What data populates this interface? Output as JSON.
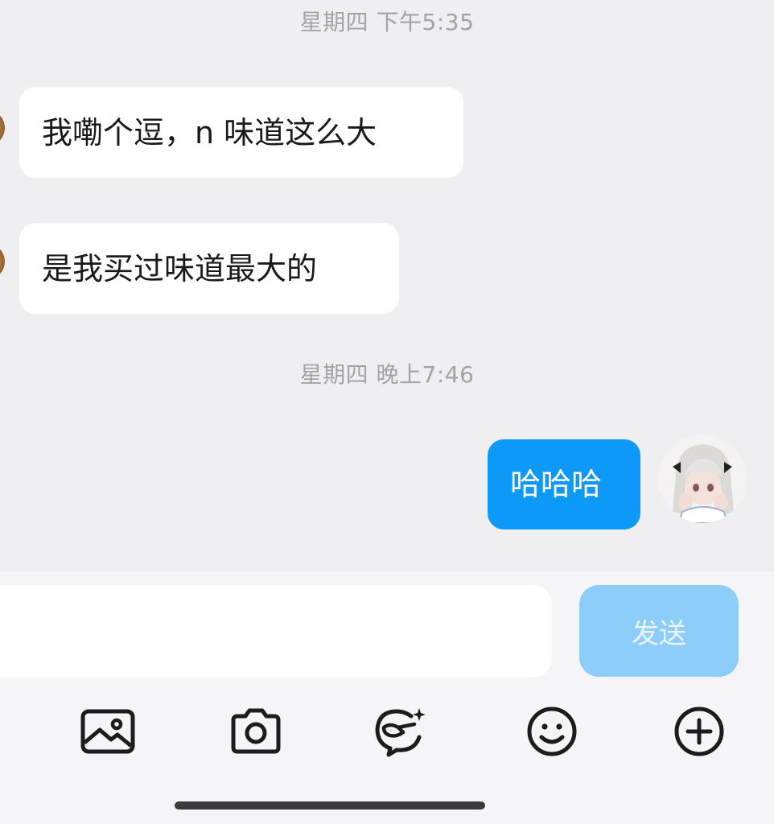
{
  "conversation": {
    "messages": [
      {
        "time": "星期四 下午5:35"
      },
      {
        "sender": "peer",
        "text": "我嘞个逗，n 味道这么大"
      },
      {
        "sender": "peer",
        "text": "是我买过味道最大的"
      },
      {
        "time": "星期四 晚上7:46"
      },
      {
        "sender": "self",
        "text": "哈哈哈"
      }
    ]
  },
  "composer": {
    "input_value": "",
    "send_label": "发送"
  },
  "toolbar": {
    "icons": [
      "image-icon",
      "camera-icon",
      "ai-assistant-icon",
      "emoji-icon",
      "plus-icon"
    ]
  },
  "colors": {
    "outgoing_bubble": "#0c99f7",
    "send_button_disabled": "#8ccdf9",
    "chat_background": "#efeff1"
  }
}
